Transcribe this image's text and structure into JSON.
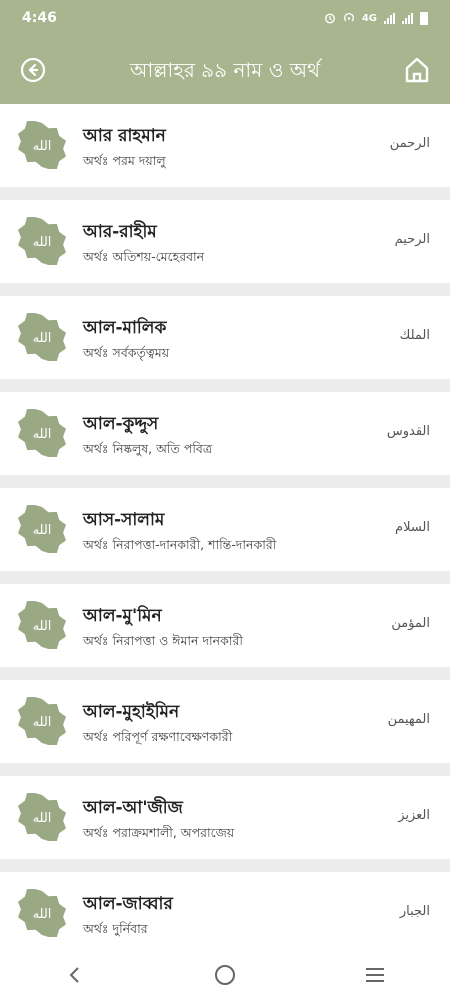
{
  "status": {
    "time": "4:46",
    "network": "4G"
  },
  "appbar": {
    "title": "আল্লাহর ৯৯ নাম ও অর্থ"
  },
  "badge_text": "الله",
  "names": [
    {
      "en": "আর রাহমান",
      "meaning": "অর্থঃ পরম দয়ালু",
      "ar": "الرحمن"
    },
    {
      "en": "আর-রাহীম",
      "meaning": "অর্থঃ অতিশয়-মেহেরবান",
      "ar": "الرحيم"
    },
    {
      "en": "আল-মালিক",
      "meaning": "অর্থঃ সর্বকর্তৃত্বময়",
      "ar": "الملك"
    },
    {
      "en": "আল-কুদ্দুস",
      "meaning": "অর্থঃ নিষ্কলুষ, অতি পবিত্র",
      "ar": "القدوس"
    },
    {
      "en": "আস-সালাম",
      "meaning": "অর্থঃ নিরাপত্তা-দানকারী, শান্তি-দানকারী",
      "ar": "السلام"
    },
    {
      "en": "আল-মু'মিন",
      "meaning": "অর্থঃ নিরাপত্তা ও ঈমান দানকারী",
      "ar": "المؤمن"
    },
    {
      "en": "আল-মুহাইমিন",
      "meaning": "অর্থঃ পরিপূর্ণ রক্ষণাবেক্ষণকারী",
      "ar": "المهيمن"
    },
    {
      "en": "আল-আ'জীজ",
      "meaning": "অর্থঃ পরাক্রমশালী, অপরাজেয়",
      "ar": "العزيز"
    },
    {
      "en": "আল-জাব্বার",
      "meaning": "অর্থঃ দুর্নিবার",
      "ar": "الجبار"
    }
  ],
  "colors": {
    "accent": "#a8b58f",
    "badge": "#9aa883"
  }
}
